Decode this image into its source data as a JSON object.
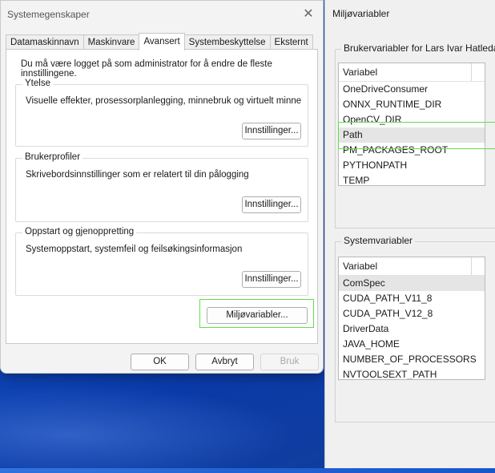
{
  "system_properties": {
    "title": "Systemegenskaper",
    "tabs": [
      "Datamaskinnavn",
      "Maskinvare",
      "Avansert",
      "Systembeskyttelse",
      "Eksternt"
    ],
    "admin_note": "Du må være logget på som administrator for å endre de fleste innstillingene.",
    "performance": {
      "label": "Ytelse",
      "description": "Visuelle effekter, prosessorplanlegging, minnebruk og virtuelt minne",
      "button": "Innstillinger..."
    },
    "user_profiles": {
      "label": "Brukerprofiler",
      "description": "Skrivebordsinnstillinger som er relatert til din pålogging",
      "button": "Innstillinger..."
    },
    "startup_recovery": {
      "label": "Oppstart og gjenoppretting",
      "description": "Systemoppstart, systemfeil og feilsøkingsinformasjon",
      "button": "Innstillinger..."
    },
    "env_button": "Miljøvariabler...",
    "ok": "OK",
    "cancel": "Avbryt",
    "apply": "Bruk"
  },
  "env_vars": {
    "title": "Miljøvariabler",
    "user_group_label": "Brukervariabler for Lars Ivar Hatledal",
    "user_column_header": "Variabel",
    "user_vars": [
      "OneDriveConsumer",
      "ONNX_RUNTIME_DIR",
      "OpenCV_DIR",
      "Path",
      "PM_PACKAGES_ROOT",
      "PYTHONPATH",
      "TEMP"
    ],
    "system_group_label": "Systemvariabler",
    "system_column_header": "Variabel",
    "system_vars": [
      "ComSpec",
      "CUDA_PATH_V11_8",
      "CUDA_PATH_V12_8",
      "DriverData",
      "JAVA_HOME",
      "NUMBER_OF_PROCESSORS",
      "NVTOOLSEXT_PATH"
    ]
  },
  "colors": {
    "highlight": "#63dd4a",
    "desktop": "#1450c8"
  }
}
